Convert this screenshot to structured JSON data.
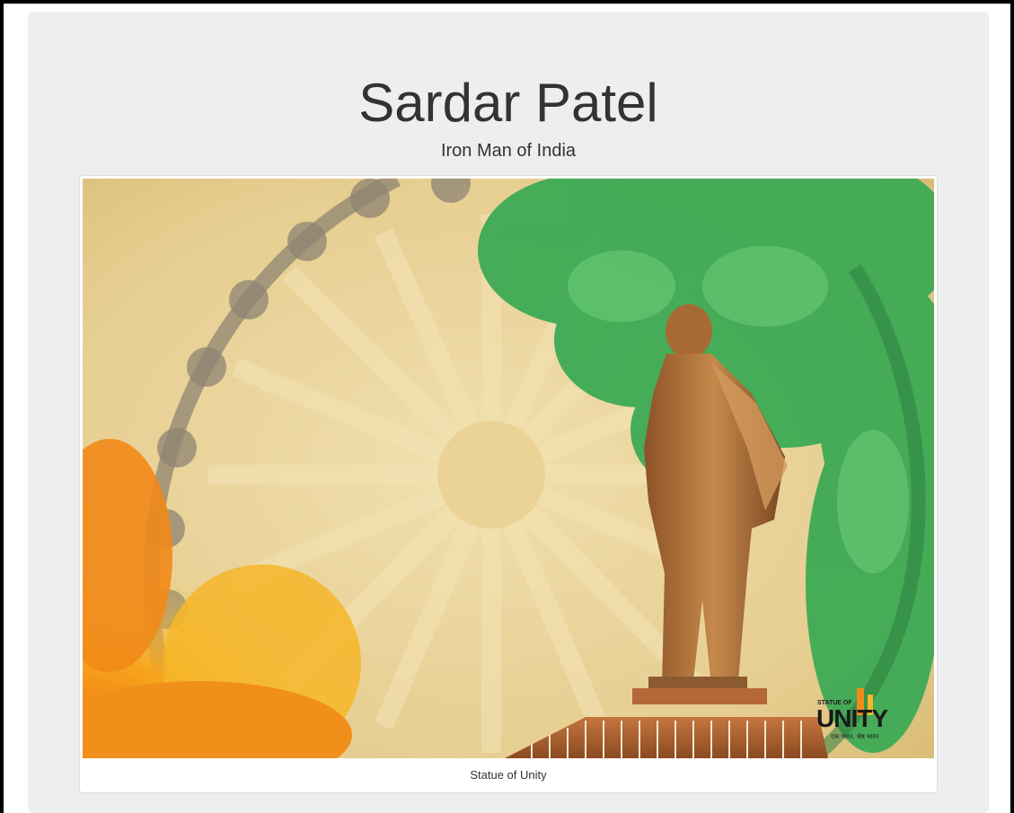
{
  "page": {
    "title": "Sardar Patel",
    "subtitle": "Iron Man of India"
  },
  "figure": {
    "image_alt": "Statue of Unity",
    "caption": "Statue of Unity",
    "logo": {
      "line1": "STATUE OF",
      "line2": "UNITY",
      "tagline": "एक भारत, श्रेष्ठ भारत"
    }
  },
  "colors": {
    "background": "#eeeeee",
    "text": "#333333",
    "saffron": "#f39a1c",
    "green": "#3fb25a",
    "paper": "#e9d39a",
    "statue": "#b9783c"
  }
}
